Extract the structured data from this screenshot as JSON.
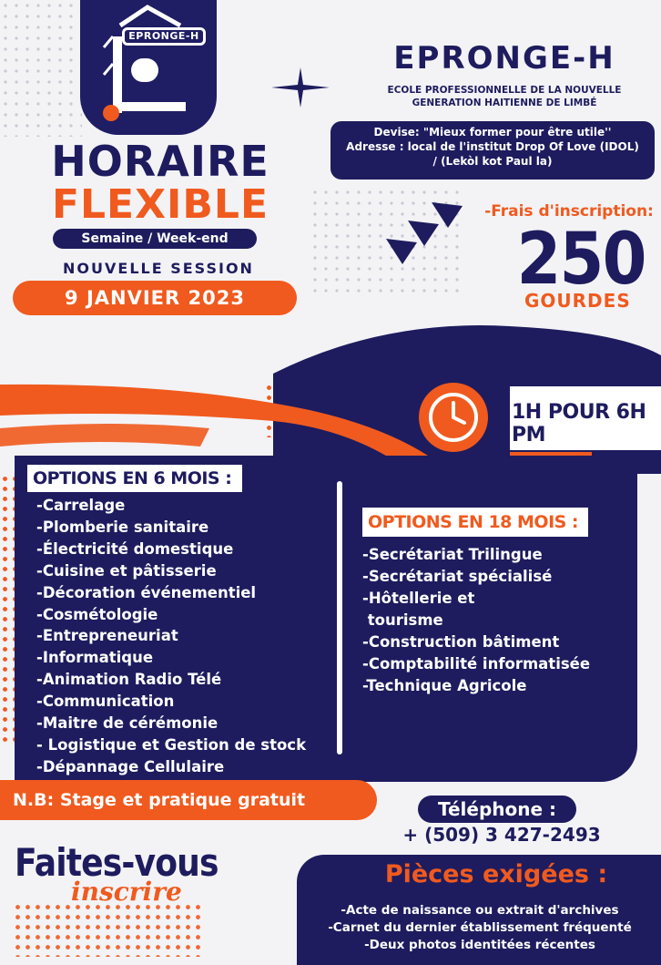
{
  "logo": {
    "badge": "EPRONGE-H"
  },
  "headline": {
    "line1": "HORAIRE",
    "line2": "FLEXIBLE",
    "schedule": "Semaine / Week-end",
    "session": "NOUVELLE SESSION",
    "date": "9 JANVIER 2023"
  },
  "school": {
    "name": "EPRONGE-H",
    "full_name_1": "ECOLE PROFESSIONNELLE DE LA NOUVELLE",
    "full_name_2": "GENERATION HAITIENNE DE LIMBÉ",
    "devise": "Devise: \"Mieux former pour être utile''",
    "adresse_1": "Adresse : local de l'institut Drop Of Love (IDOL)",
    "adresse_2": "/ (Lekòl kot Paul la)"
  },
  "fees": {
    "label": "-Frais d'inscription:",
    "amount": "250",
    "currency": "GOURDES"
  },
  "hours": {
    "text": "1H POUR 6H PM"
  },
  "options_6": {
    "title": "OPTIONS EN 6 MOIS :",
    "items": [
      "-Carrelage",
      "-Plomberie sanitaire",
      "-Électricité domestique",
      "-Cuisine et pâtisserie",
      "-Décoration événementiel",
      "-Cosmétologie",
      "-Entrepreneuriat",
      "-Informatique",
      "-Animation Radio Télé",
      "-Communication",
      "-Maitre de cérémonie",
      "- Logistique et Gestion de stock",
      "-Dépannage Cellulaire"
    ]
  },
  "options_18": {
    "title": "OPTIONS EN 18 MOIS :",
    "items": [
      "-Secrétariat Trilingue",
      "-Secrétariat spécialisé",
      "-Hôtellerie et",
      " tourisme",
      "-Construction bâtiment",
      "-Comptabilité informatisée",
      "-Technique Agricole"
    ]
  },
  "nb": "N.B: Stage et pratique gratuit",
  "contact": {
    "label": "Téléphone :",
    "phone": "+ (509) 3 427-2493"
  },
  "cta": {
    "main": "Faites-vous",
    "script": "inscrire"
  },
  "pieces": {
    "title": "Pièces exigées :",
    "items": [
      "-Acte de naissance ou extrait d'archives",
      "-Carnet du dernier établissement fréquenté",
      "-Deux photos identitées récentes"
    ]
  },
  "colors": {
    "navy": "#1e1c5e",
    "orange": "#f05a1e"
  }
}
